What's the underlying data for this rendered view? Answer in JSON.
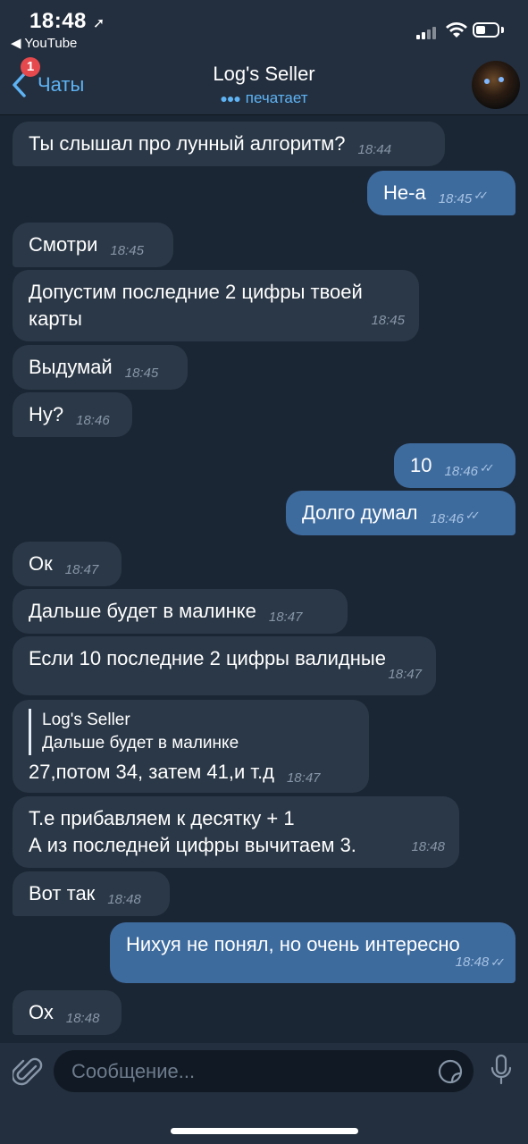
{
  "status_bar": {
    "time": "18:48",
    "back_app": "◀ YouTube"
  },
  "header": {
    "back_label": "Чаты",
    "badge_count": "1",
    "title": "Log's Seller",
    "subtitle": "печатает"
  },
  "messages": [
    {
      "dir": "in",
      "text": "Ты слышал про лунный алгоритм?",
      "time": "18:44"
    },
    {
      "dir": "out",
      "text": "Не-а",
      "time": "18:45"
    },
    {
      "dir": "in",
      "text": "Смотри",
      "time": "18:45"
    },
    {
      "dir": "in",
      "line1": "Допустим последние 2 цифры твоей",
      "line2": "карты",
      "time": "18:45"
    },
    {
      "dir": "in",
      "text": "Выдумай",
      "time": "18:45"
    },
    {
      "dir": "in",
      "text": "Ну?",
      "time": "18:46"
    },
    {
      "dir": "out",
      "text": "10",
      "time": "18:46"
    },
    {
      "dir": "out",
      "text": "Долго думал",
      "time": "18:46"
    },
    {
      "dir": "in",
      "text": "Ок",
      "time": "18:47"
    },
    {
      "dir": "in",
      "text": "Дальше будет в малинке",
      "time": "18:47"
    },
    {
      "dir": "in",
      "text": "Если 10 последние 2 цифры валидные",
      "time": "18:47"
    },
    {
      "dir": "in",
      "reply_name": "Log's Seller",
      "reply_text": "Дальше будет в малинке",
      "text": "27,потом 34, затем 41,и т.д",
      "time": "18:47"
    },
    {
      "dir": "in",
      "line1": "Т.е прибавляем к десятку + 1",
      "line2": "А из последней цифры вычитаем 3.",
      "time": "18:48"
    },
    {
      "dir": "in",
      "text": "Вот так",
      "time": "18:48"
    },
    {
      "dir": "out",
      "text": "Нихуя не понял, но очень интересно",
      "time": "18:48"
    },
    {
      "dir": "in",
      "text": "Ох",
      "time": "18:48"
    }
  ],
  "composer": {
    "placeholder": "Сообщение..."
  },
  "colors": {
    "background": "#1b2634",
    "incoming_bubble": "#2b3847",
    "outgoing_bubble": "#3e6b9e",
    "accent": "#5eb3f4"
  }
}
